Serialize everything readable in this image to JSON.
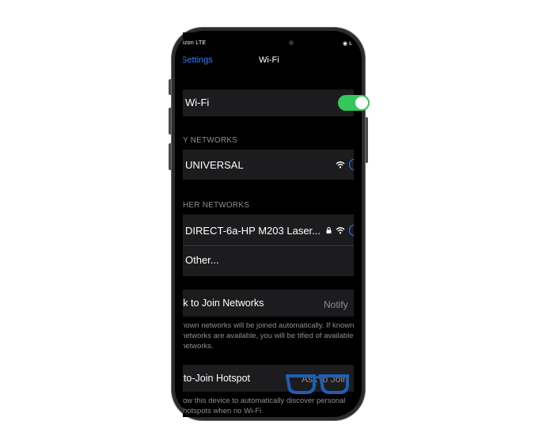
{
  "status_bar": {
    "carrier": "izon  LTE",
    "battery": "◉ 8"
  },
  "nav": {
    "back_label": "Settings",
    "title": "Wi-Fi"
  },
  "wifi_toggle": {
    "label": "Wi-Fi",
    "state": "on"
  },
  "my_networks": {
    "header": "Y NETWORKS",
    "items": [
      {
        "name": "UNIVERSAL",
        "icons": [
          "wifi-icon",
          "info-icon"
        ]
      }
    ]
  },
  "other_networks": {
    "header": "HER NETWORKS",
    "items": [
      {
        "name": "DIRECT-6a-HP M203 Laser...",
        "icons": [
          "lock-icon",
          "wifi-icon",
          "info-icon"
        ]
      },
      {
        "name": "Other..."
      }
    ]
  },
  "ask_to_join": {
    "label": "sk to Join Networks",
    "value": "Notify",
    "description": "nown networks will be joined automatically. If  known networks are available, you will be tified of available networks."
  },
  "auto_join_hotspot": {
    "label": "uto-Join Hotspot",
    "value": "Ask to Join",
    "description": "ow this device to automatically discover  personal hotspots when no Wi-Fi"
  },
  "colors": {
    "accent": "#2f7fff",
    "toggle_on": "#34c759",
    "group_bg": "#1c1c1e",
    "secondary_text": "#8e8e93",
    "overlay_glasses": "#1e5fb3"
  }
}
